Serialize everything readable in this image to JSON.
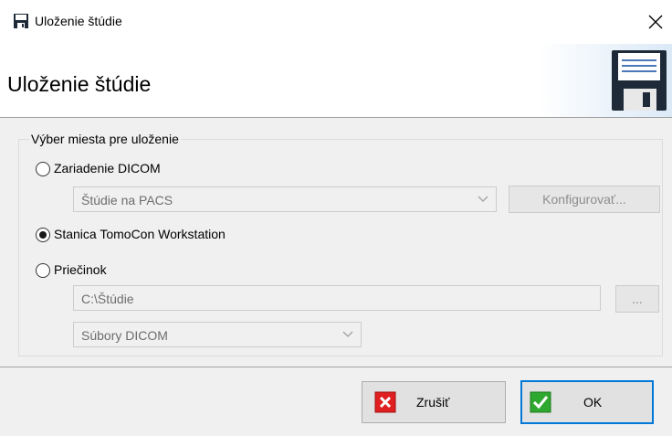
{
  "window": {
    "title": "Uloženie štúdie",
    "close_glyph": "✕"
  },
  "header": {
    "title": "Uloženie štúdie",
    "icon": "floppy-disk-icon"
  },
  "group": {
    "legend": "Výber miesta pre uloženie",
    "options": [
      {
        "label": "Zariadenie DICOM",
        "selected": false,
        "dropdown_value": "Štúdie na PACS",
        "configure_label": "Konfigurovať..."
      },
      {
        "label": "Stanica TomoCon Workstation",
        "selected": true
      },
      {
        "label": "Priečinok",
        "selected": false,
        "path_value": "C:\\Štúdie",
        "browse_label": "...",
        "format_value": "Súbory DICOM"
      }
    ]
  },
  "buttons": {
    "cancel_label": "Zrušiť",
    "ok_label": "OK"
  },
  "colors": {
    "accent": "#0078d7",
    "cancel_red": "#e02020",
    "ok_green": "#2fa82f"
  }
}
